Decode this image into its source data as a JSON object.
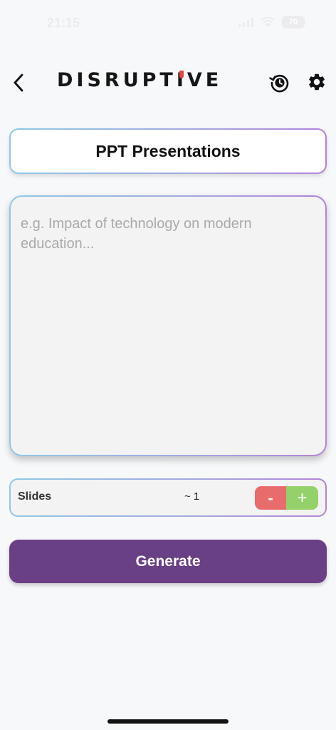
{
  "status_bar": {
    "time": "21:15",
    "battery": "70"
  },
  "header": {
    "logo_before": "DISRUPT",
    "logo_i": "I",
    "logo_after": "VE",
    "back_icon": "chevron-left-icon",
    "history_icon": "history-icon",
    "settings_icon": "gear-icon",
    "logo_accent_color": "#e2463c"
  },
  "main": {
    "title": "PPT Presentations",
    "prompt": {
      "value": "",
      "placeholder": "e.g. Impact of technology on modern education..."
    },
    "slides": {
      "label": "Slides",
      "value": "~ 1",
      "minus_label": "-",
      "plus_label": "+"
    },
    "generate_label": "Generate"
  },
  "colors": {
    "accent": "#693f86",
    "minus": "#e96c6c",
    "plus": "#95d16b",
    "border_gradient_start": "#8ec9e6",
    "border_gradient_end": "#b283db"
  }
}
